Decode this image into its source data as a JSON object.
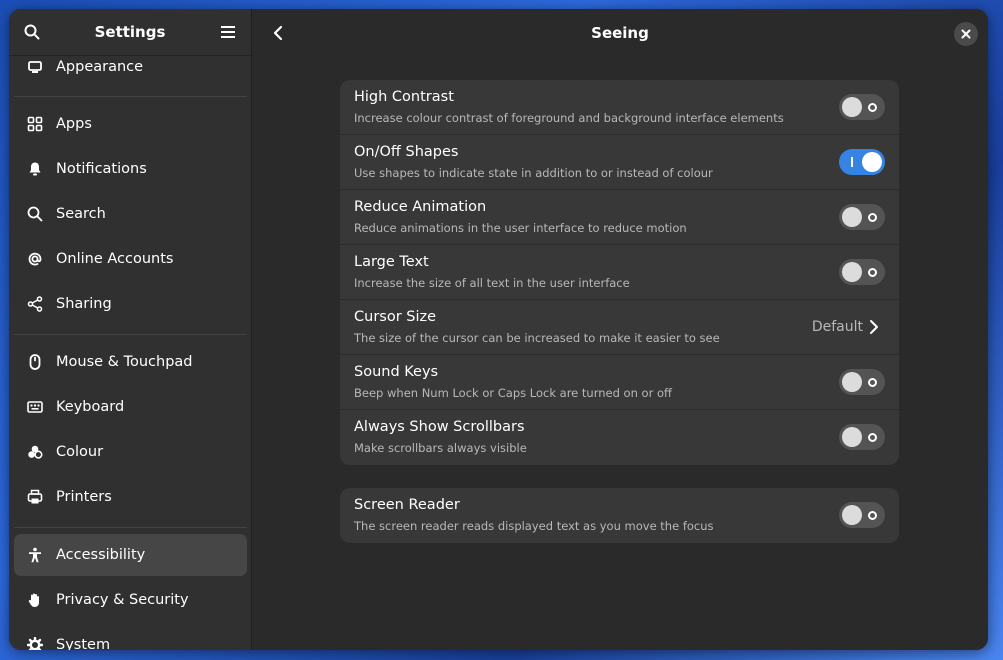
{
  "sidebar": {
    "title": "Settings",
    "search_icon": "search-icon",
    "menu_icon": "hamburger-menu-icon",
    "items": [
      {
        "label": "Appearance",
        "icon": "appearance-icon"
      },
      {
        "label": "Apps",
        "icon": "apps-grid-icon"
      },
      {
        "label": "Notifications",
        "icon": "bell-icon"
      },
      {
        "label": "Search",
        "icon": "search-icon"
      },
      {
        "label": "Online Accounts",
        "icon": "at-sign-icon"
      },
      {
        "label": "Sharing",
        "icon": "share-icon"
      },
      {
        "label": "Mouse & Touchpad",
        "icon": "mouse-icon"
      },
      {
        "label": "Keyboard",
        "icon": "keyboard-icon"
      },
      {
        "label": "Colour",
        "icon": "colour-icon"
      },
      {
        "label": "Printers",
        "icon": "printer-icon"
      },
      {
        "label": "Accessibility",
        "icon": "accessibility-icon"
      },
      {
        "label": "Privacy & Security",
        "icon": "hand-icon"
      },
      {
        "label": "System",
        "icon": "gear-icon"
      }
    ],
    "active_index": 10
  },
  "main": {
    "title": "Seeing",
    "groups": [
      {
        "rows": [
          {
            "title": "High Contrast",
            "subtitle": "Increase colour contrast of foreground and background interface elements",
            "type": "toggle",
            "on": false
          },
          {
            "title": "On/Off Shapes",
            "subtitle": "Use shapes to indicate state in addition to or instead of colour",
            "type": "toggle",
            "on": true
          },
          {
            "title": "Reduce Animation",
            "subtitle": "Reduce animations in the user interface to reduce motion",
            "type": "toggle",
            "on": false
          },
          {
            "title": "Large Text",
            "subtitle": "Increase the size of all text in the user interface",
            "type": "toggle",
            "on": false
          },
          {
            "title": "Cursor Size",
            "subtitle": "The size of the cursor can be increased to make it easier to see",
            "type": "link",
            "value": "Default"
          },
          {
            "title": "Sound Keys",
            "subtitle": "Beep when Num Lock or Caps Lock are turned on or off",
            "type": "toggle",
            "on": false
          },
          {
            "title": "Always Show Scrollbars",
            "subtitle": "Make scrollbars always visible",
            "type": "toggle",
            "on": false
          }
        ]
      },
      {
        "rows": [
          {
            "title": "Screen Reader",
            "subtitle": "The screen reader reads displayed text as you move the focus",
            "type": "toggle",
            "on": false
          }
        ]
      }
    ]
  },
  "colors": {
    "accent": "#3584e4",
    "window_bg": "#2a2a2a",
    "sidebar_bg": "#303030",
    "card_bg": "#383838"
  }
}
